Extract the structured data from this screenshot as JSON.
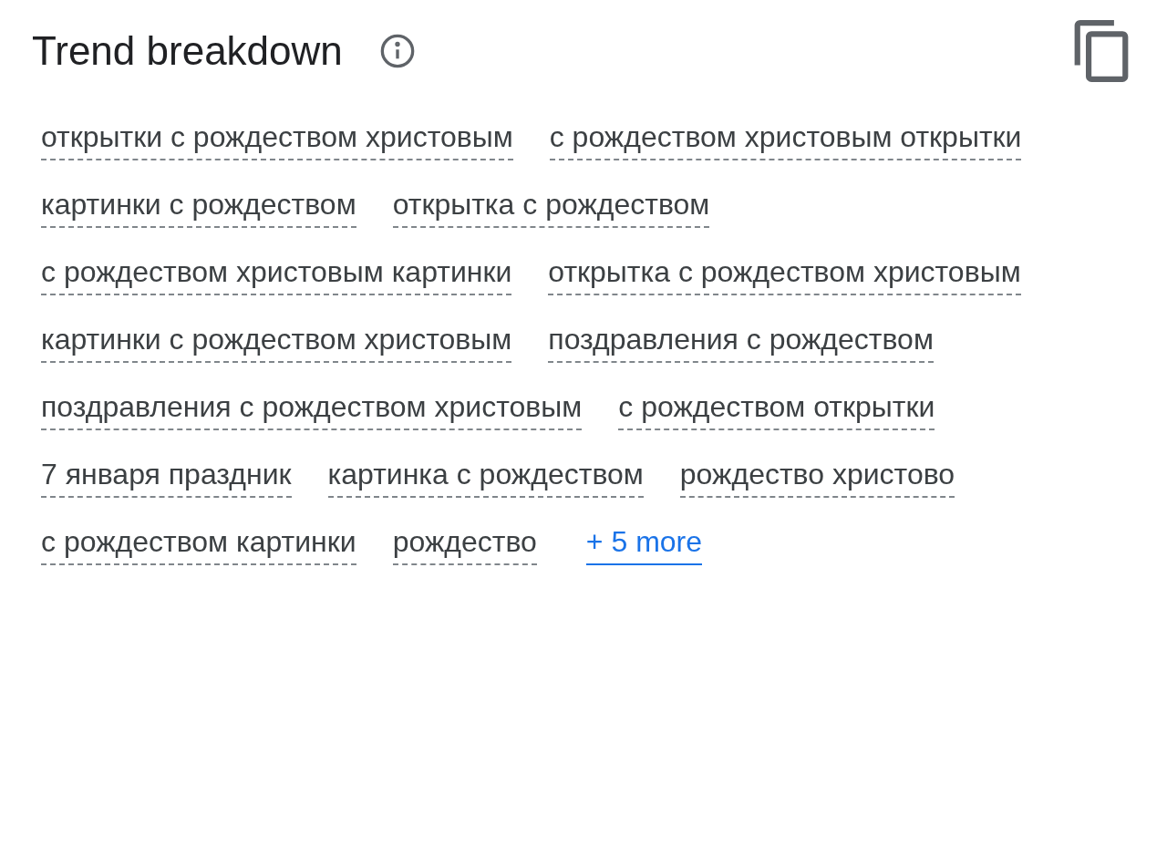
{
  "title": "Trend breakdown",
  "terms": [
    "открытки с рождеством христовым",
    "с рождеством христовым открытки",
    "картинки с рождеством",
    "открытка с рождеством",
    "с рождеством христовым картинки",
    "открытка с рождеством христовым",
    "картинки с рождеством христовым",
    "поздравления с рождеством",
    "поздравления с рождеством христовым",
    "с рождеством открытки",
    "7 января праздник",
    "картинка с рождеством",
    "рождество христово",
    "с рождеством картинки",
    "рождество"
  ],
  "more_link": "+ 5 more"
}
